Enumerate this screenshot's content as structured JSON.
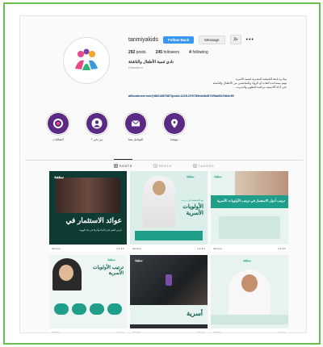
{
  "profile": {
    "username": "tanmiyakids",
    "follow_label": "Follow Back",
    "message_label": "Message",
    "stats": {
      "posts": "292",
      "posts_label": "posts",
      "followers": "245",
      "followers_label": "followers",
      "following": "4",
      "following_label": "following"
    },
    "name": "نادي تنمية الأطفال والناشئة",
    "category": "Education",
    "bio_lines": [
      "مبادرة تابعة للجمعية المصرية لتنمية الأسرة",
      "تهتم بمساعدة القادة أو الرواد والمختصين من الأطفال والناشئة",
      "نحن أداة أكاديمية مرحلية للتطوير والتدريب"
    ],
    "link": "allbookuser.ws/@8821887867/post=1225.2V5789eddb4574f5ad522fd4e99"
  },
  "highlights": [
    {
      "label": "الفعاليات",
      "icon": "target-icon"
    },
    {
      "label": "من نحن ؟",
      "icon": "user-icon"
    },
    {
      "label": "التواصل معنا",
      "icon": "mail-icon"
    },
    {
      "label": "موقعنا",
      "icon": "location-pin-icon"
    }
  ],
  "tabs": [
    {
      "label": "POSTS",
      "active": true
    },
    {
      "label": "REELS",
      "active": false
    },
    {
      "label": "TAGGED",
      "active": false
    }
  ],
  "posts": [
    {
      "brand": "سقفة",
      "title": "عوائد الاستثمار في",
      "subtitle": "غرس القيم لدى الأبناء وأثرها في بناء الهوية",
      "footer": "tanmiya"
    },
    {
      "brand": "سقفة",
      "title": "الأولويات الأسرية",
      "subtitle": "مع التخطيط في ترتيب",
      "footer": "tanmiya"
    },
    {
      "brand": "سقفة",
      "title": "ترتيب أدوار الاستثمار في ترتيب الأولويات الأسرية",
      "subtitle": "",
      "footer": "tanmiya"
    },
    {
      "brand": "سقفة",
      "title": "ترتيب الأولويات الأسرية",
      "subtitle": "",
      "footer": "tanmiya"
    },
    {
      "brand": "سقفة",
      "title": "أسرية",
      "subtitle": "",
      "footer": "tanmiya"
    },
    {
      "brand": "سقفة",
      "title": "",
      "subtitle": "",
      "footer": "tanmiya"
    }
  ],
  "colors": {
    "accent": "#3897f0",
    "highlight": "#5a2a84",
    "teal": "#1f9e8a",
    "frame": "#6bbf4e"
  }
}
